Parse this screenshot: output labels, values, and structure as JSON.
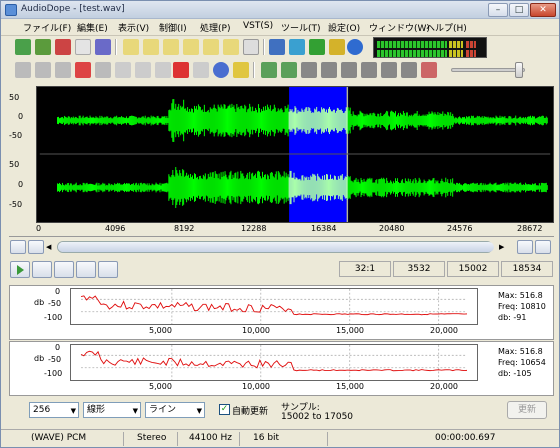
{
  "window": {
    "title": "AudioDope - [test.wav]",
    "min": "–",
    "max": "□",
    "close": "✕"
  },
  "menu": [
    {
      "label": "ファイル(F)"
    },
    {
      "label": "編集(E)"
    },
    {
      "label": "表示(V)"
    },
    {
      "label": "制御(I)"
    },
    {
      "label": "処理(P)"
    },
    {
      "label": "VST(S)"
    },
    {
      "label": "ツール(T)"
    },
    {
      "label": "設定(O)"
    },
    {
      "label": "ウィンドウ(W)"
    },
    {
      "label": "ヘルプ(H)"
    }
  ],
  "waveform": {
    "channels": [
      {
        "ticks": [
          "50",
          "0",
          "-50"
        ]
      },
      {
        "ticks": [
          "50",
          "0",
          "-50"
        ]
      }
    ],
    "selection_color": "#0000ff",
    "wave_color": "#00ff00",
    "ruler": [
      "0",
      "4096",
      "8192",
      "12288",
      "16384",
      "20480",
      "24576",
      "28672"
    ]
  },
  "transport": {
    "zoom_ratio": "32:1",
    "pos1": "3532",
    "pos2": "15002",
    "pos3": "18534"
  },
  "spectrum": [
    {
      "ylabel": "db",
      "yticks": [
        "0",
        "-50",
        "-100"
      ],
      "xticks": [
        "5,000",
        "10,000",
        "15,000",
        "20,000"
      ],
      "max": "Max: 516.8",
      "freq": "Freq: 10810",
      "db": "db: -91"
    },
    {
      "ylabel": "db",
      "yticks": [
        "0",
        "-50",
        "-100"
      ],
      "xticks": [
        "5,000",
        "10,000",
        "15,000",
        "20,000"
      ],
      "max": "Max: 516.8",
      "freq": "Freq: 10654",
      "db": "db: -105"
    }
  ],
  "controls": {
    "fft_size": "256",
    "scale": "線形",
    "style": "ライン",
    "auto_update_label": "自動更新",
    "auto_update_checked": true,
    "sample_label": "サンプル:",
    "sample_range": "15002 to 17050",
    "update_button": "更新"
  },
  "status": {
    "format": "(WAVE) PCM",
    "channels": "Stereo",
    "rate": "44100 Hz",
    "bits": "16 bit",
    "time": "00:00:00.697"
  }
}
